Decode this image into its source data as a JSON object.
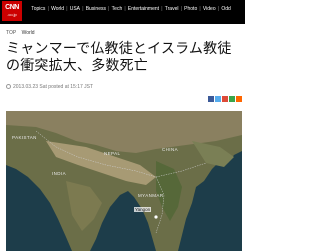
{
  "header": {
    "logo_text": "CNN",
    "logo_sub": ".co.jp",
    "nav": [
      "Topics",
      "World",
      "USA",
      "Business",
      "Tech",
      "Entertainment",
      "Travel",
      "Photo",
      "Video",
      "Odd"
    ]
  },
  "breadcrumb": [
    "TOP",
    "World"
  ],
  "article": {
    "headline": "ミャンマーで仏教徒とイスラム教徒の衝突拡大、多数死亡",
    "dateline": "2013.03.23 Sat posted at 15:17 JST"
  },
  "map": {
    "labels": {
      "pakistan": "PAKISTAN",
      "nepal": "NEPAL",
      "china": "CHINA",
      "india": "INDIA",
      "myanmar": "MYANMAR",
      "yangon": "Yangon"
    }
  },
  "colors": {
    "topbar": "#000000",
    "logo_red": "#cc0000",
    "ocean": "#1d3d4a"
  }
}
